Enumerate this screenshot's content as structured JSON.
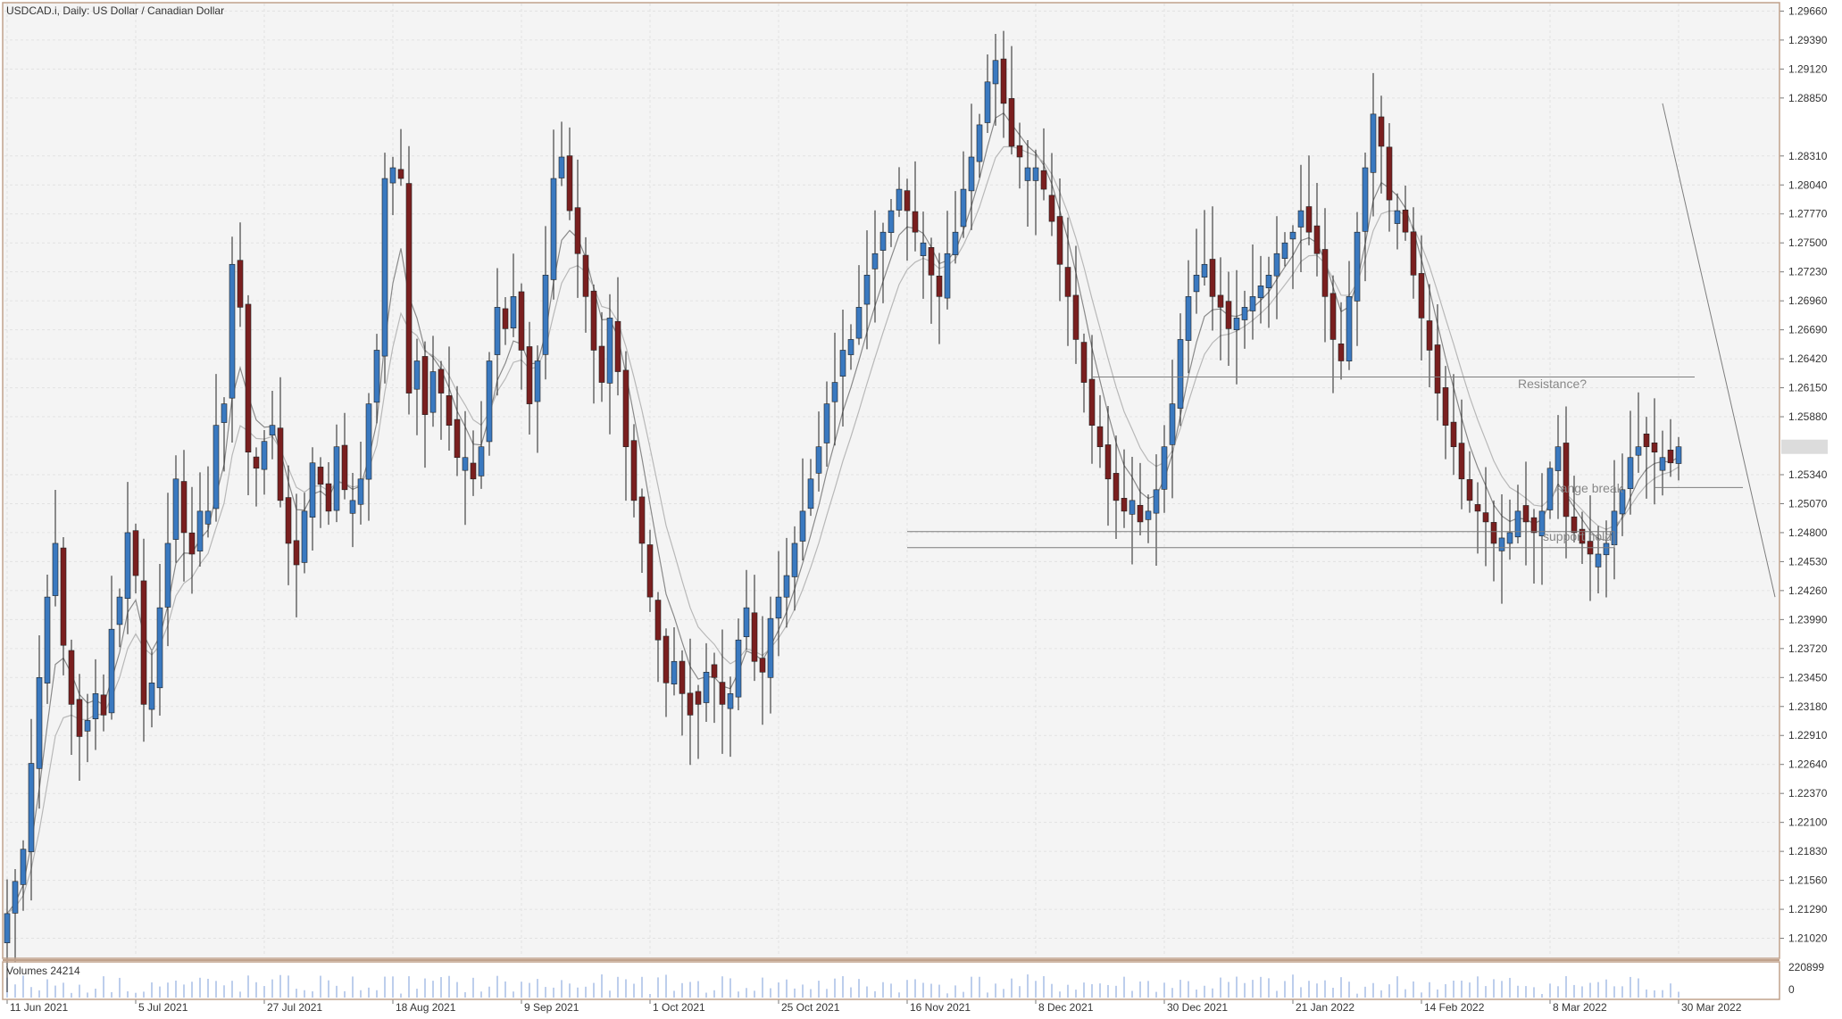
{
  "header": {
    "symbol_label": "USDCAD.i, Daily:  US Dollar / Canadian Dollar"
  },
  "volume_panel": {
    "label": "Volumes 24214",
    "scale_max": "220899",
    "scale_min": "0"
  },
  "annotations": {
    "resistance": "Resistance?",
    "range_break": "range break",
    "support_hold": "support hold"
  },
  "colors": {
    "background": "#f4f4f4",
    "frame": "#c0a28c",
    "grid": "#e2e2e2",
    "bull": "#3a79c0",
    "bear": "#7a1f1f",
    "wick": "#202020",
    "ma_fast": "#8a8a8a",
    "ma_slow": "#b8b8b8",
    "trendline": "#7d7d7d",
    "volume": "#a7bde6",
    "current_price_tag": "#dcdcdc"
  },
  "chart_data": {
    "type": "candlestick",
    "symbol": "USDCAD.i",
    "timeframe": "Daily",
    "ylim": [
      1.2085,
      1.2973
    ],
    "y_ticks": [
      "1.29660",
      "1.29390",
      "1.29120",
      "1.28850",
      "1.28310",
      "1.28040",
      "1.27770",
      "1.27500",
      "1.27230",
      "1.26960",
      "1.26690",
      "1.26420",
      "1.26150",
      "1.25880",
      "1.25340",
      "1.25070",
      "1.24800",
      "1.24530",
      "1.24260",
      "1.23990",
      "1.23720",
      "1.23450",
      "1.23180",
      "1.22910",
      "1.22640",
      "1.22370",
      "1.22100",
      "1.21830",
      "1.21560",
      "1.21290",
      "1.21020"
    ],
    "x_ticks": [
      {
        "label": "11 Jun 2021",
        "bar": 0
      },
      {
        "label": "5 Jul 2021",
        "bar": 16
      },
      {
        "label": "27 Jul 2021",
        "bar": 32
      },
      {
        "label": "18 Aug 2021",
        "bar": 48
      },
      {
        "label": "9 Sep 2021",
        "bar": 64
      },
      {
        "label": "1 Oct 2021",
        "bar": 80
      },
      {
        "label": "25 Oct 2021",
        "bar": 96
      },
      {
        "label": "16 Nov 2021",
        "bar": 112
      },
      {
        "label": "8 Dec 2021",
        "bar": 128
      },
      {
        "label": "30 Dec 2021",
        "bar": 144
      },
      {
        "label": "21 Jan 2022",
        "bar": 160
      },
      {
        "label": "14 Feb 2022",
        "bar": 176
      },
      {
        "label": "8 Mar 2022",
        "bar": 192
      },
      {
        "label": "30 Mar 2022",
        "bar": 208
      }
    ],
    "bars_total": 215,
    "closes": [
      1.2125,
      1.2155,
      1.2185,
      1.2265,
      1.2345,
      1.242,
      1.247,
      1.2375,
      1.232,
      1.229,
      1.2305,
      1.233,
      1.231,
      1.239,
      1.242,
      1.248,
      1.244,
      1.232,
      1.234,
      1.241,
      1.247,
      1.253,
      1.248,
      1.246,
      1.25,
      1.25,
      1.258,
      1.26,
      1.273,
      1.269,
      1.2555,
      1.254,
      1.2565,
      1.258,
      1.251,
      1.247,
      1.245,
      1.25,
      1.2545,
      1.2525,
      1.25,
      1.256,
      1.252,
      1.251,
      1.253,
      1.26,
      1.265,
      1.281,
      1.282,
      1.281,
      1.261,
      1.264,
      1.259,
      1.263,
      1.261,
      1.258,
      1.255,
      1.255,
      1.253,
      1.256,
      1.264,
      1.269,
      1.267,
      1.27,
      1.265,
      1.26,
      1.264,
      1.272,
      1.281,
      1.283,
      1.278,
      1.274,
      1.27,
      1.265,
      1.262,
      1.268,
      1.263,
      1.256,
      1.251,
      1.247,
      1.242,
      1.238,
      1.234,
      1.236,
      1.233,
      1.231,
      1.232,
      1.235,
      1.2345,
      1.232,
      1.233,
      1.238,
      1.241,
      1.236,
      1.235,
      1.24,
      1.242,
      1.244,
      1.247,
      1.25,
      1.253,
      1.256,
      1.26,
      1.262,
      1.265,
      1.266,
      1.269,
      1.272,
      1.274,
      1.276,
      1.278,
      1.28,
      1.278,
      1.276,
      1.275,
      1.272,
      1.27,
      1.274,
      1.276,
      1.28,
      1.283,
      1.286,
      1.29,
      1.292,
      1.288,
      1.284,
      1.283,
      1.282,
      1.282,
      1.28,
      1.277,
      1.273,
      1.27,
      1.266,
      1.262,
      1.258,
      1.256,
      1.253,
      1.251,
      1.25,
      1.251,
      1.249,
      1.25,
      1.252,
      1.256,
      1.26,
      1.266,
      1.27,
      1.272,
      1.273,
      1.27,
      1.269,
      1.267,
      1.268,
      1.269,
      1.27,
      1.271,
      1.272,
      1.274,
      1.275,
      1.276,
      1.278,
      1.276,
      1.274,
      1.27,
      1.266,
      1.264,
      1.27,
      1.276,
      1.282,
      1.287,
      1.284,
      1.279,
      1.278,
      1.276,
      1.272,
      1.268,
      1.265,
      1.261,
      1.258,
      1.256,
      1.253,
      1.251,
      1.25,
      1.249,
      1.247,
      1.2475,
      1.248,
      1.25,
      1.249,
      1.248,
      1.25,
      1.254,
      1.256,
      1.2495,
      1.248,
      1.247,
      1.246,
      1.246,
      1.247,
      1.25,
      1.252,
      1.255,
      1.256,
      1.256,
      1.2555,
      1.255,
      1.2545,
      1.256
    ]
  }
}
